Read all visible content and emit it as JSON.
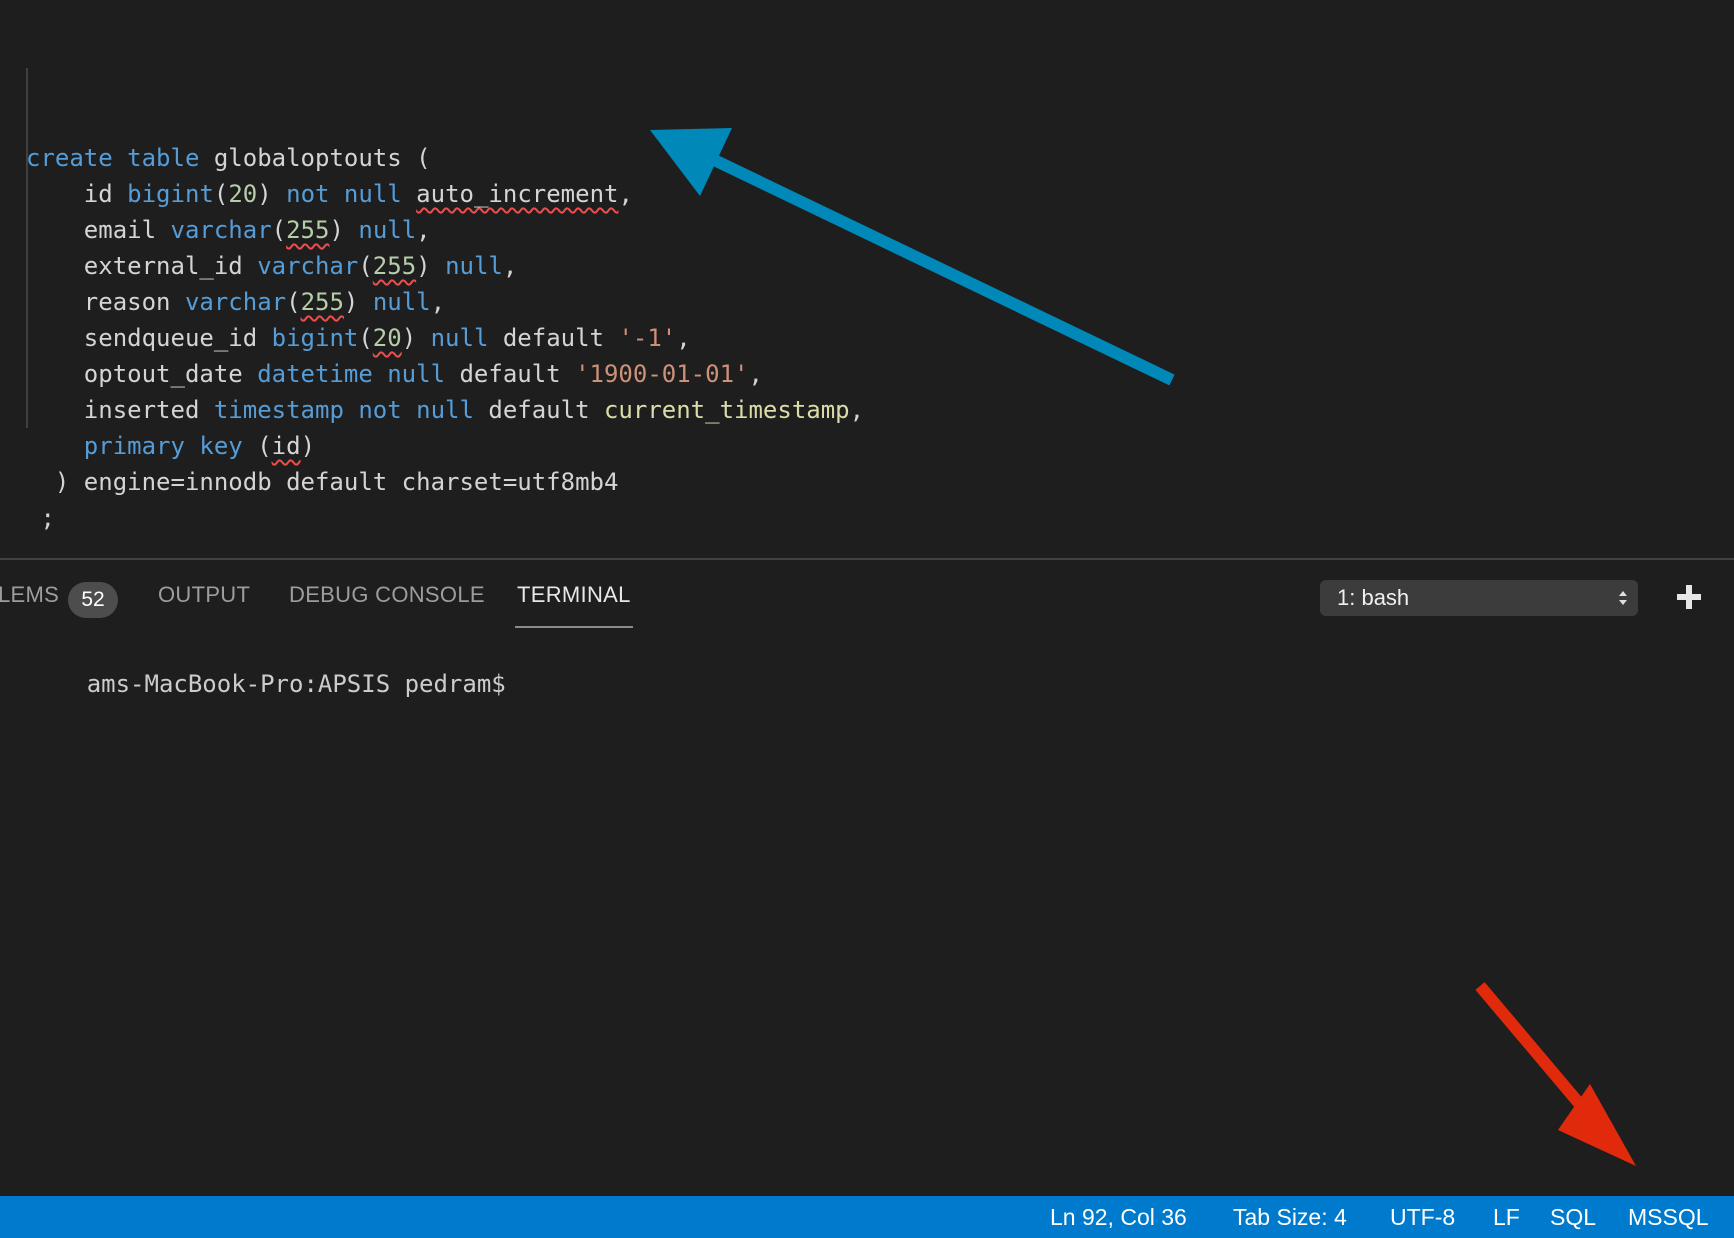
{
  "editor": {
    "lines": [
      [
        {
          "t": "create",
          "c": "kw"
        },
        {
          "t": " "
        },
        {
          "t": "table",
          "c": "kw"
        },
        {
          "t": " globaloptouts ("
        }
      ],
      [
        {
          "t": "    id "
        },
        {
          "t": "bigint",
          "c": "kw"
        },
        {
          "t": "("
        },
        {
          "t": "20",
          "c": "num"
        },
        {
          "t": ") "
        },
        {
          "t": "not null",
          "c": "kw"
        },
        {
          "t": " "
        },
        {
          "t": "auto_increment",
          "s": true
        },
        {
          "t": ","
        }
      ],
      [
        {
          "t": "    email "
        },
        {
          "t": "varchar",
          "c": "kw"
        },
        {
          "t": "("
        },
        {
          "t": "255",
          "c": "num",
          "s": true
        },
        {
          "t": ") "
        },
        {
          "t": "null",
          "c": "kw"
        },
        {
          "t": ","
        }
      ],
      [
        {
          "t": "    external_id "
        },
        {
          "t": "varchar",
          "c": "kw"
        },
        {
          "t": "("
        },
        {
          "t": "255",
          "c": "num",
          "s": true
        },
        {
          "t": ") "
        },
        {
          "t": "null",
          "c": "kw"
        },
        {
          "t": ","
        }
      ],
      [
        {
          "t": "    reason "
        },
        {
          "t": "varchar",
          "c": "kw"
        },
        {
          "t": "("
        },
        {
          "t": "255",
          "c": "num",
          "s": true
        },
        {
          "t": ") "
        },
        {
          "t": "null",
          "c": "kw"
        },
        {
          "t": ","
        }
      ],
      [
        {
          "t": "    sendqueue_id "
        },
        {
          "t": "bigint",
          "c": "kw"
        },
        {
          "t": "("
        },
        {
          "t": "20",
          "c": "num",
          "s": true
        },
        {
          "t": ") "
        },
        {
          "t": "null",
          "c": "kw"
        },
        {
          "t": " default "
        },
        {
          "t": "'-1'",
          "c": "str"
        },
        {
          "t": ","
        }
      ],
      [
        {
          "t": "    optout_date "
        },
        {
          "t": "datetime",
          "c": "kw"
        },
        {
          "t": " "
        },
        {
          "t": "null",
          "c": "kw"
        },
        {
          "t": " default "
        },
        {
          "t": "'1900-01-01'",
          "c": "str"
        },
        {
          "t": ","
        }
      ],
      [
        {
          "t": "    inserted "
        },
        {
          "t": "timestamp",
          "c": "kw"
        },
        {
          "t": " "
        },
        {
          "t": "not null",
          "c": "kw"
        },
        {
          "t": " default "
        },
        {
          "t": "current_timestamp",
          "c": "fn"
        },
        {
          "t": ","
        }
      ],
      [
        {
          "t": "    "
        },
        {
          "t": "primary key",
          "c": "kw"
        },
        {
          "t": " ("
        },
        {
          "t": "id",
          "s": true
        },
        {
          "t": ")"
        }
      ],
      [
        {
          "t": "  ) engine=innodb default charset=utf8mb4"
        }
      ],
      [
        {
          "t": " ;"
        }
      ]
    ]
  },
  "panel": {
    "tabs": [
      {
        "label": "LEMS",
        "active": false
      },
      {
        "label": "OUTPUT",
        "active": false
      },
      {
        "label": "DEBUG CONSOLE",
        "active": false
      },
      {
        "label": "TERMINAL",
        "active": true
      }
    ],
    "problems_count": "52",
    "terminal_select": "1: bash",
    "prompt": "ams-MacBook-Pro:APSIS pedram$"
  },
  "statusbar": {
    "position": "Ln 92, Col 36",
    "tab_size": "Tab Size: 4",
    "encoding": "UTF-8",
    "eol": "LF",
    "language": "SQL",
    "connection": "MSSQL"
  },
  "colors": {
    "background": "#1e1e1e",
    "statusbar": "#007acc",
    "keyword": "#569cd6",
    "number": "#b5cea8",
    "string": "#ce9178",
    "function": "#dcdcaa",
    "annotation_arrow_blue": "#0088b8",
    "annotation_arrow_red": "#e12a0c"
  }
}
